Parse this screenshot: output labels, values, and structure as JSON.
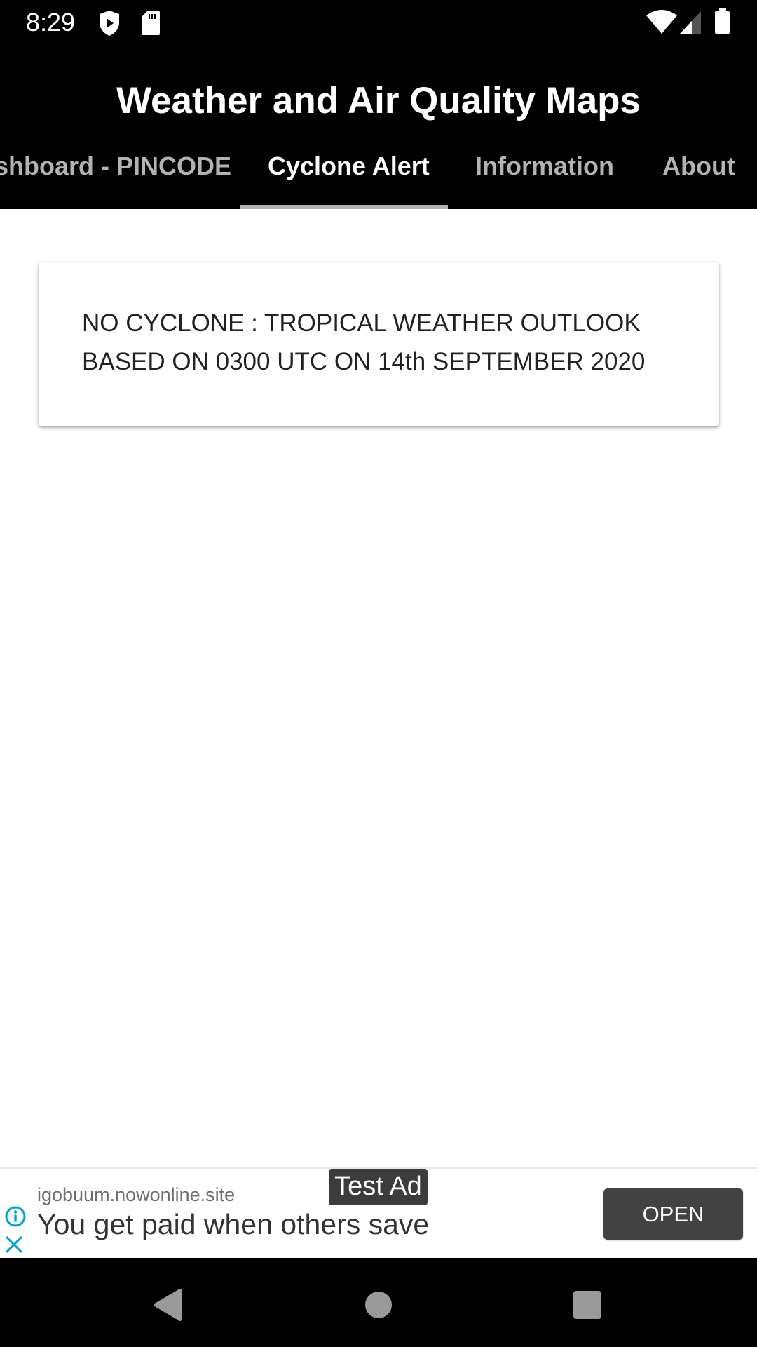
{
  "status_bar": {
    "time": "8:29",
    "left_icons": [
      "play-protect-icon",
      "sd-card-icon"
    ],
    "right_icons": [
      "wifi-icon",
      "cell-signal-icon",
      "battery-icon"
    ]
  },
  "app_bar": {
    "title": "Weather and Air Quality Maps",
    "tabs": [
      {
        "label": "Dashboard - PINCODE",
        "visible_text": "shboard - PINCODE",
        "active": false
      },
      {
        "label": "Cyclone Alert",
        "active": true
      },
      {
        "label": "Information",
        "active": false
      },
      {
        "label": "About",
        "active": false
      }
    ],
    "colors": {
      "background": "#000000",
      "active_tab": "#ffffff",
      "inactive_tab": "#b3b3b3",
      "indicator": "#b3b3b3"
    }
  },
  "main": {
    "alert_card": {
      "line1": "NO CYCLONE : TROPICAL WEATHER OUTLOOK",
      "line2": "BASED ON 0300 UTC ON 14th SEPTEMBER 2020"
    }
  },
  "ad_banner": {
    "badge": "Test Ad",
    "domain": "igobuum.nowonline.site",
    "headline": "You get paid when others save",
    "cta": "OPEN",
    "icons": [
      "info-icon",
      "close-icon"
    ],
    "accent": "#00a3c4"
  },
  "nav_bar": {
    "buttons": [
      "back",
      "home",
      "recents"
    ]
  }
}
